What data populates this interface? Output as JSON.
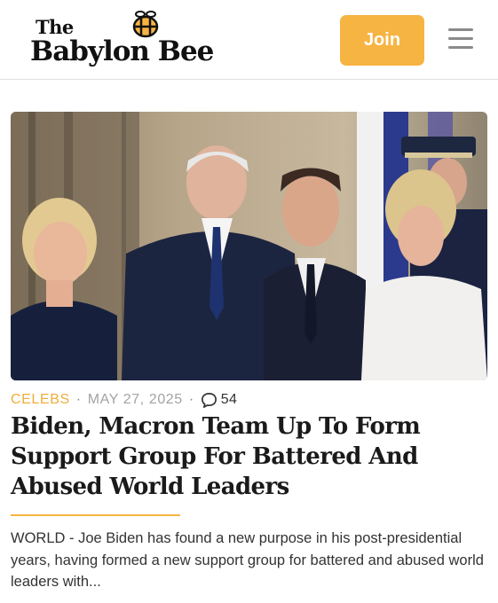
{
  "header": {
    "logo_line1": "The",
    "logo_line2": "Babylon Bee",
    "join_label": "Join",
    "accent_color": "#f6b442"
  },
  "article": {
    "image_icon": "photo-of-four-people",
    "category": "CELEBS",
    "date": "MAY 27, 2025",
    "comment_icon": "speech-bubble-icon",
    "comment_count": "54",
    "headline": "Biden, Macron Team Up To Form Support Group For Battered And Abused World Leaders",
    "excerpt": "WORLD - Joe Biden has found a new purpose in his post-presidential years, having formed a new support group for battered and abused world leaders with..."
  }
}
